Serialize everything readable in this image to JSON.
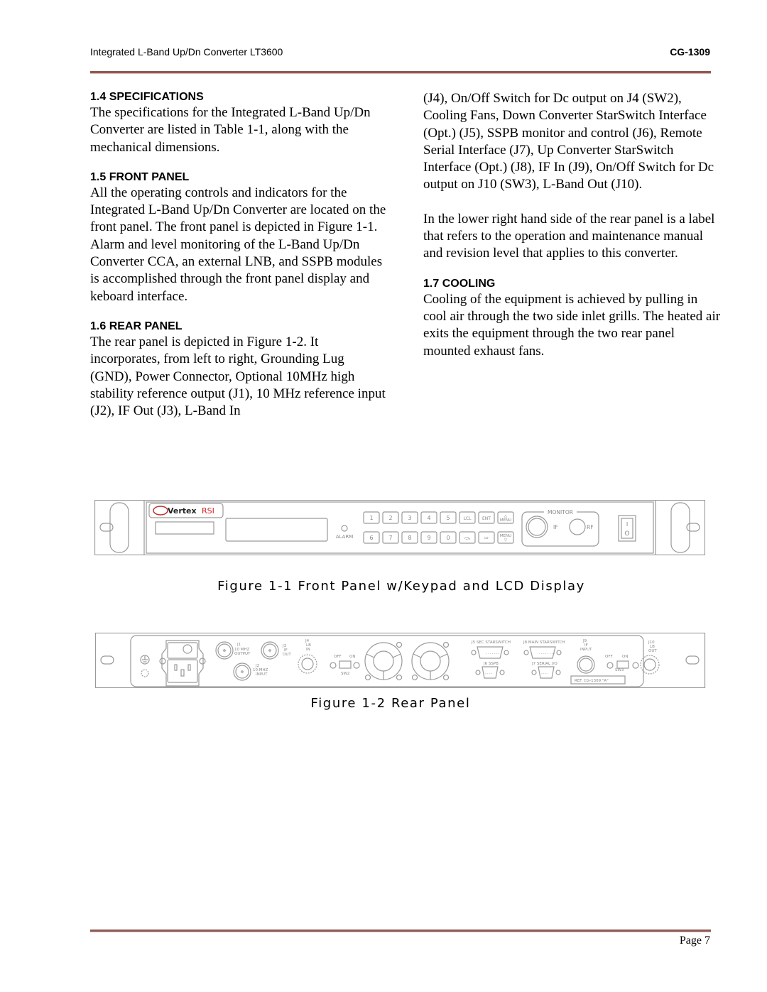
{
  "header": {
    "title": "Integrated L-Band Up/Dn Converter  LT3600",
    "doc_id": "CG-1309"
  },
  "sections": [
    {
      "heading": "1.4 SPECIFICATIONS",
      "paragraphs": [
        "The specifications for the Integrated L-Band Up/Dn Converter are listed in Table 1-1, along with the mechanical dimensions."
      ]
    },
    {
      "heading": "1.5 FRONT PANEL",
      "paragraphs": [
        "All the operating controls and indicators for the Integrated L-Band Up/Dn Converter are located on the front panel. The front panel is depicted in Figure 1-1. Alarm and level monitoring of the L-Band Up/Dn Converter CCA, an external LNB, and SSPB modules is accomplished through the front panel display and keboard interface."
      ]
    },
    {
      "heading": "1.6 REAR PANEL",
      "paragraphs": [
        "The rear panel is depicted in Figure 1-2. It incorporates, from left to right, Grounding Lug (GND), Power Connector, Optional 10MHz high stability reference output (J1), 10 MHz reference input (J2), IF Out (J3), L-Band In",
        "(J4), On/Off Switch for Dc output on J4 (SW2), Cooling Fans, Down Converter StarSwitch Interface (Opt.) (J5), SSPB monitor and control (J6),   Remote Serial Interface (J7), Up Converter StarSwitch Interface (Opt.) (J8), IF In (J9), On/Off Switch for Dc output on J10 (SW3), L-Band Out (J10).",
        "In the lower right hand side of the rear panel is a label that refers to the operation and maintenance manual and revision level that applies to this converter."
      ]
    },
    {
      "heading": "1.7 COOLING",
      "paragraphs": [
        "Cooling of the equipment is achieved by pulling in cool air through the two side inlet grills. The heated air exits the equipment through the two rear panel mounted exhaust fans."
      ]
    }
  ],
  "front_panel": {
    "logo_main": "Vertex",
    "logo_accent": "RSI",
    "alarm_label": "ALARM",
    "keys_row1": [
      "1",
      "2",
      "3",
      "4",
      "5",
      "LCL",
      "ENT",
      "△ MENU"
    ],
    "keys_row2": [
      "6",
      "7",
      "8",
      "9",
      "0",
      "⤼",
      "⇨",
      "MENU ▽"
    ],
    "monitor_label": "MONITOR",
    "if_label": "IF",
    "rf_label": "RF",
    "switch_on": "I",
    "switch_off": "O"
  },
  "rear_panel": {
    "j1_label": [
      "J1",
      "10 MHZ",
      "OUTPUT"
    ],
    "j2_label": [
      "J2",
      "10 MHZ",
      "INPUT"
    ],
    "j3_label": [
      "J3",
      "IF",
      "OUT"
    ],
    "j4_label": [
      "J4",
      "LB",
      "IN"
    ],
    "sw2": {
      "off": "OFF",
      "on": "ON",
      "name": "SW2"
    },
    "j5_label": "J5 SEC STARSWITCH",
    "j8_label": "J8 MAIN STARSWITCH",
    "j6_label": "J6 SSPB",
    "j7_label": "J7 SERIAL I/O",
    "j9_label": [
      "J9",
      "IF",
      "INPUT"
    ],
    "sw3": {
      "off": "OFF",
      "on": "ON",
      "name": "SW3"
    },
    "j10_label": [
      "J10",
      "LB",
      "OUT"
    ],
    "ref_label": "REF. CG-1309 \"A\""
  },
  "figures": {
    "fig1_caption": "Figure 1-1   Front Panel w/Keypad and LCD Display",
    "fig2_caption": "Figure 1-2   Rear Panel"
  },
  "footer": {
    "page": "Page 7"
  },
  "colors": {
    "rule": "#8c5a58",
    "logo_red": "#d42020",
    "drawing_line": "#9a9a9a"
  }
}
